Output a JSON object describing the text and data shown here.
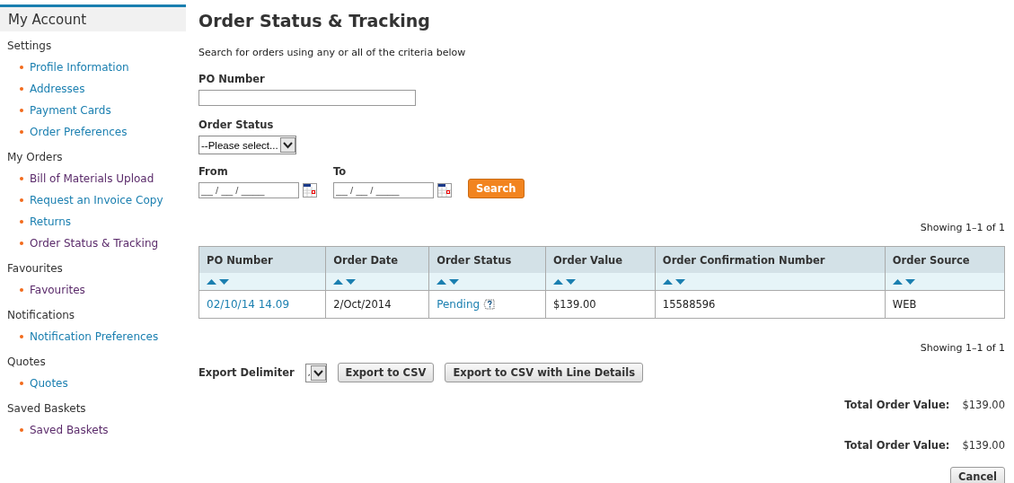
{
  "sidebar": {
    "title": "My Account",
    "sections": [
      {
        "heading": "Settings",
        "items": [
          {
            "label": "Profile Information",
            "visited": false
          },
          {
            "label": "Addresses",
            "visited": false
          },
          {
            "label": "Payment Cards",
            "visited": false
          },
          {
            "label": "Order Preferences",
            "visited": false
          }
        ]
      },
      {
        "heading": "My Orders",
        "items": [
          {
            "label": "Bill of Materials Upload",
            "visited": true
          },
          {
            "label": "Request an Invoice Copy",
            "visited": false
          },
          {
            "label": "Returns",
            "visited": false
          },
          {
            "label": "Order Status & Tracking",
            "visited": true
          }
        ]
      },
      {
        "heading": "Favourites",
        "items": [
          {
            "label": "Favourites",
            "visited": true
          }
        ]
      },
      {
        "heading": "Notifications",
        "items": [
          {
            "label": "Notification Preferences",
            "visited": false
          }
        ]
      },
      {
        "heading": "Quotes",
        "items": [
          {
            "label": "Quotes",
            "visited": false
          }
        ]
      },
      {
        "heading": "Saved Baskets",
        "items": [
          {
            "label": "Saved Baskets",
            "visited": true
          }
        ]
      }
    ]
  },
  "page": {
    "title": "Order Status & Tracking",
    "intro": "Search for orders using any or all of the criteria below",
    "po_label": "PO Number",
    "status_label": "Order Status",
    "status_select": "--Please select...",
    "from_label": "From",
    "from_placeholder": "__ / __ / ____",
    "to_label": "To",
    "to_placeholder": "__ / __ / ____",
    "search_button": "Search",
    "showing_top": "Showing 1–1 of 1",
    "table": {
      "columns": [
        "PO Number",
        "Order Date",
        "Order Status",
        "Order Value",
        "Order Confirmation Number",
        "Order Source"
      ],
      "rows": [
        {
          "po": "02/10/14 14.09",
          "date": "2/Oct/2014",
          "status": "Pending",
          "value": "$139.00",
          "confirmation": "15588596",
          "source": "WEB"
        }
      ]
    },
    "showing_bottom": "Showing 1–1 of 1",
    "export_label": "Export Delimiter",
    "delimiter": ",",
    "export_csv": "Export to CSV",
    "export_csv_lines": "Export to CSV with Line Details",
    "totals": [
      {
        "label": "Total Order Value:",
        "value": "$139.00"
      },
      {
        "label": "Total Order Value:",
        "value": "$139.00"
      }
    ],
    "cancel_button": "Cancel"
  }
}
